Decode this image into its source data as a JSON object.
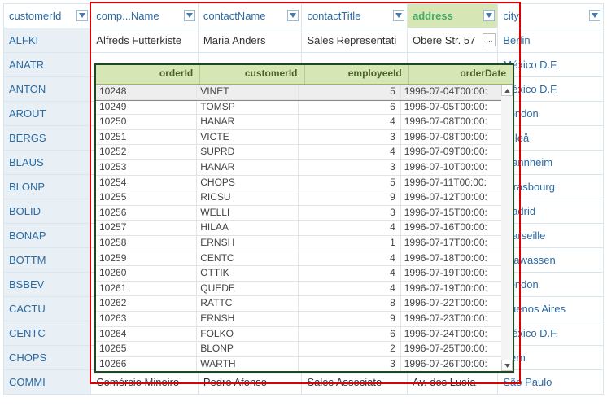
{
  "main": {
    "headers": [
      {
        "label": "customerId",
        "selected": false
      },
      {
        "label": "comp...Name",
        "selected": false
      },
      {
        "label": "contactName",
        "selected": false
      },
      {
        "label": "contactTitle",
        "selected": false
      },
      {
        "label": "address",
        "selected": true
      },
      {
        "label": "city",
        "selected": false
      }
    ],
    "rows": [
      {
        "id": "ALFKI",
        "company": "Alfreds Futterkiste",
        "contact": "Maria Anders",
        "title": "Sales Representati",
        "address": "Obere Str. 57",
        "city": "Berlin",
        "ell": true
      },
      {
        "id": "ANATR",
        "company": "",
        "contact": "",
        "title": "",
        "address": "",
        "city": "México D.F."
      },
      {
        "id": "ANTON",
        "company": "",
        "contact": "",
        "title": "",
        "address": "",
        "city": "México D.F."
      },
      {
        "id": "AROUT",
        "company": "",
        "contact": "",
        "title": "",
        "address": "",
        "city": "London"
      },
      {
        "id": "BERGS",
        "company": "",
        "contact": "",
        "title": "",
        "address": "",
        "city": "Luleå"
      },
      {
        "id": "BLAUS",
        "company": "",
        "contact": "",
        "title": "",
        "address": "",
        "city": "Mannheim"
      },
      {
        "id": "BLONP",
        "company": "",
        "contact": "",
        "title": "",
        "address": "",
        "city": "Strasbourg"
      },
      {
        "id": "BOLID",
        "company": "",
        "contact": "",
        "title": "",
        "address": "",
        "city": "Madrid"
      },
      {
        "id": "BONAP",
        "company": "",
        "contact": "",
        "title": "",
        "address": "",
        "city": "Marseille"
      },
      {
        "id": "BOTTM",
        "company": "",
        "contact": "",
        "title": "",
        "address": "",
        "city": "Tsawassen"
      },
      {
        "id": "BSBEV",
        "company": "",
        "contact": "",
        "title": "",
        "address": "",
        "city": "London"
      },
      {
        "id": "CACTU",
        "company": "",
        "contact": "",
        "title": "",
        "address": "",
        "city": "Buenos Aires"
      },
      {
        "id": "CENTC",
        "company": "",
        "contact": "",
        "title": "",
        "address": "",
        "city": "México D.F."
      },
      {
        "id": "CHOPS",
        "company": "",
        "contact": "",
        "title": "",
        "address": "",
        "city": "Bern"
      },
      {
        "id": "COMMI",
        "company": "Comércio Mineiro",
        "contact": "Pedro Afonso",
        "title": "Sales Associate",
        "address": "Av. dos Lusía",
        "city": "São Paulo"
      }
    ]
  },
  "popup": {
    "headers": [
      "orderId",
      "customerId",
      "employeeId",
      "orderDate"
    ],
    "rows": [
      {
        "orderId": "10248",
        "customerId": "VINET",
        "employeeId": "5",
        "orderDate": "1996-07-04T00:00:"
      },
      {
        "orderId": "10249",
        "customerId": "TOMSP",
        "employeeId": "6",
        "orderDate": "1996-07-05T00:00:"
      },
      {
        "orderId": "10250",
        "customerId": "HANAR",
        "employeeId": "4",
        "orderDate": "1996-07-08T00:00:"
      },
      {
        "orderId": "10251",
        "customerId": "VICTE",
        "employeeId": "3",
        "orderDate": "1996-07-08T00:00:"
      },
      {
        "orderId": "10252",
        "customerId": "SUPRD",
        "employeeId": "4",
        "orderDate": "1996-07-09T00:00:"
      },
      {
        "orderId": "10253",
        "customerId": "HANAR",
        "employeeId": "3",
        "orderDate": "1996-07-10T00:00:"
      },
      {
        "orderId": "10254",
        "customerId": "CHOPS",
        "employeeId": "5",
        "orderDate": "1996-07-11T00:00:"
      },
      {
        "orderId": "10255",
        "customerId": "RICSU",
        "employeeId": "9",
        "orderDate": "1996-07-12T00:00:"
      },
      {
        "orderId": "10256",
        "customerId": "WELLI",
        "employeeId": "3",
        "orderDate": "1996-07-15T00:00:"
      },
      {
        "orderId": "10257",
        "customerId": "HILAA",
        "employeeId": "4",
        "orderDate": "1996-07-16T00:00:"
      },
      {
        "orderId": "10258",
        "customerId": "ERNSH",
        "employeeId": "1",
        "orderDate": "1996-07-17T00:00:"
      },
      {
        "orderId": "10259",
        "customerId": "CENTC",
        "employeeId": "4",
        "orderDate": "1996-07-18T00:00:"
      },
      {
        "orderId": "10260",
        "customerId": "OTTIK",
        "employeeId": "4",
        "orderDate": "1996-07-19T00:00:"
      },
      {
        "orderId": "10261",
        "customerId": "QUEDE",
        "employeeId": "4",
        "orderDate": "1996-07-19T00:00:"
      },
      {
        "orderId": "10262",
        "customerId": "RATTC",
        "employeeId": "8",
        "orderDate": "1996-07-22T00:00:"
      },
      {
        "orderId": "10263",
        "customerId": "ERNSH",
        "employeeId": "9",
        "orderDate": "1996-07-23T00:00:"
      },
      {
        "orderId": "10264",
        "customerId": "FOLKO",
        "employeeId": "6",
        "orderDate": "1996-07-24T00:00:"
      },
      {
        "orderId": "10265",
        "customerId": "BLONP",
        "employeeId": "2",
        "orderDate": "1996-07-25T00:00:"
      },
      {
        "orderId": "10266",
        "customerId": "WARTH",
        "employeeId": "3",
        "orderDate": "1996-07-26T00:00:"
      }
    ]
  },
  "icons": {
    "ellipsis": "..."
  }
}
